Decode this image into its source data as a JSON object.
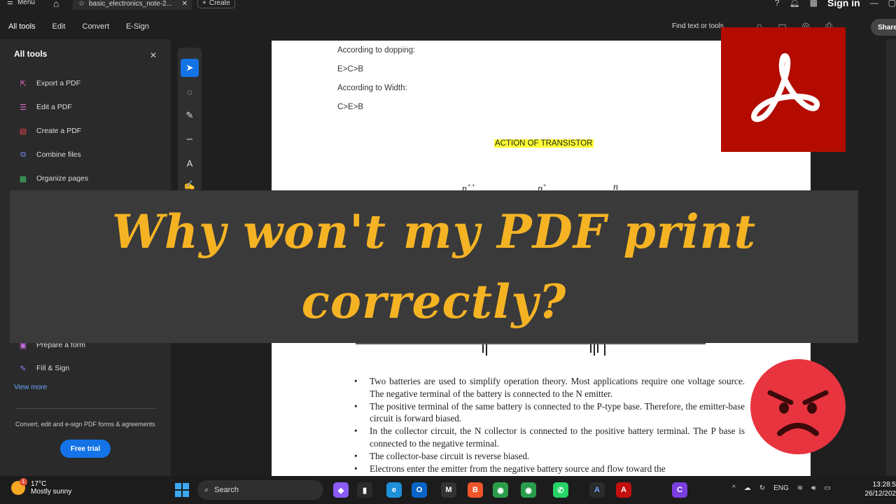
{
  "titlebar": {
    "menu_label": "Menu",
    "tab_title": "basic_electronics_note-2...",
    "create_label": "Create",
    "signin_label": "Sign in"
  },
  "toolbar": {
    "tabs": [
      "All tools",
      "Edit",
      "Convert",
      "E-Sign"
    ],
    "find_label": "Find text or tools",
    "share_label": "Share"
  },
  "left_panel": {
    "title": "All tools",
    "items": [
      {
        "label": "Export a PDF",
        "icon": "export-pdf-icon",
        "color": "#e06bc4"
      },
      {
        "label": "Edit a PDF",
        "icon": "edit-pdf-icon",
        "color": "#e06bc4"
      },
      {
        "label": "Create a PDF",
        "icon": "create-pdf-icon",
        "color": "#e8434a"
      },
      {
        "label": "Combine files",
        "icon": "combine-files-icon",
        "color": "#7b8cf5"
      },
      {
        "label": "Organize pages",
        "icon": "organize-pages-icon",
        "color": "#3fbf6a"
      },
      {
        "label": "Prepare a form",
        "icon": "prepare-form-icon",
        "color": "#c46ce0"
      },
      {
        "label": "Fill & Sign",
        "icon": "fill-sign-icon",
        "color": "#9c7cf5"
      }
    ],
    "view_more": "View more",
    "promo": "Convert, edit and e-sign PDF forms & agreements",
    "free_trial": "Free trial"
  },
  "document": {
    "lines": [
      "According to dopping:",
      "E>C>B",
      "According to Width:",
      "C>E>B"
    ],
    "heading": "ACTION OF TRANSISTOR",
    "bullets": [
      "Two batteries are used to simplify operation theory. Most applications require one voltage source. The negative terminal of the battery is connected to the N emitter.",
      "The positive terminal of the same battery is connected to the P-type base. Therefore, the emitter-base circuit is forward biased.",
      "In the collector circuit, the N collector is connected to the positive battery terminal. The P base is connected to the negative terminal.",
      "The collector-base circuit is reverse biased.",
      "Electrons enter the emitter from the negative battery source and flow toward the"
    ]
  },
  "banner": {
    "line1": "Why won't my PDF print",
    "line2": "correctly?",
    "text_color": "#f5b324"
  },
  "taskbar": {
    "temperature": "17°C",
    "weather": "Mostly sunny",
    "weather_badge": "1",
    "search_label": "Search",
    "language": "ENG",
    "time": "13:28:5",
    "date": "26/12/202"
  },
  "colors": {
    "accent": "#1473e6",
    "acrobat_red": "#b30b00",
    "highlight": "#ffff33"
  }
}
